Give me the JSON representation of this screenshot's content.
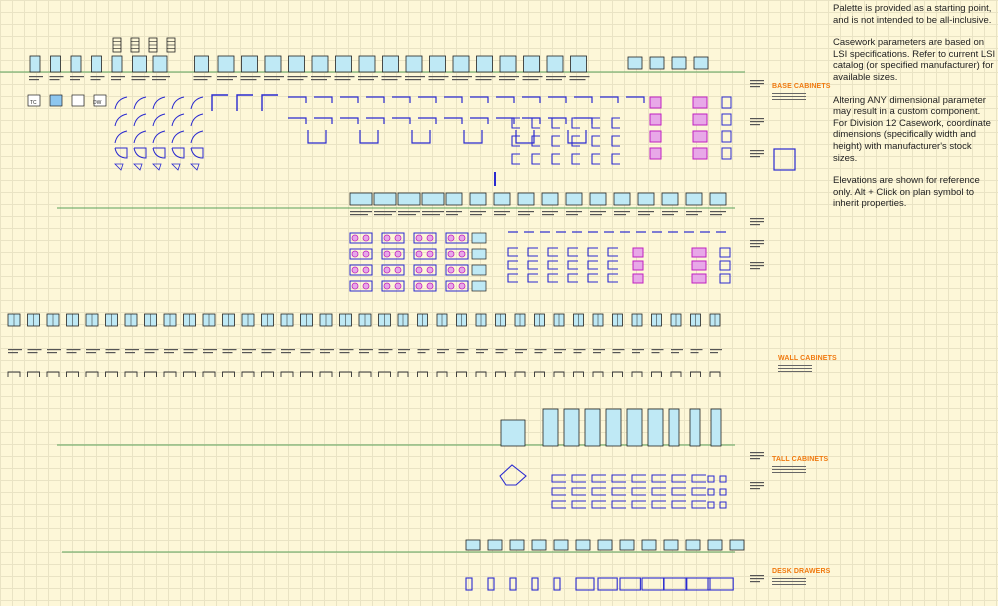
{
  "notes": {
    "p1": "Palette is provided as a starting point, and is not intended to be all-inclusive.",
    "p2": "Casework parameters are based on LSI specifications.  Refer to current LSI catalog (or specified manufacturer) for available sizes.",
    "p3": "Altering ANY dimensional parameter may result in a custom component. For Division 12 Casework, coordinate dimensions (specifically width and height) with manufacturer's stock sizes.",
    "p4": "Elevations are shown for reference only.  Alt + Click on plan symbol to inherit properties."
  },
  "sections": {
    "base": "BASE CABINETS",
    "wall": "WALL CABINETS",
    "tall": "TALL CABINETS",
    "desk": "DESK DRAWERS"
  },
  "symbol_codes": [
    "TC",
    "DW"
  ],
  "colors": {
    "background": "#fdf7d8",
    "grid": "#e9e3c4",
    "plan_stroke": "#2a2ad0",
    "elevation_fill": "#bfe9f5",
    "drawer_fill": "#e8a8e8",
    "drawer_stroke": "#c020c0",
    "floor_line": "#5aa05a",
    "section_label": "#f07a10"
  }
}
